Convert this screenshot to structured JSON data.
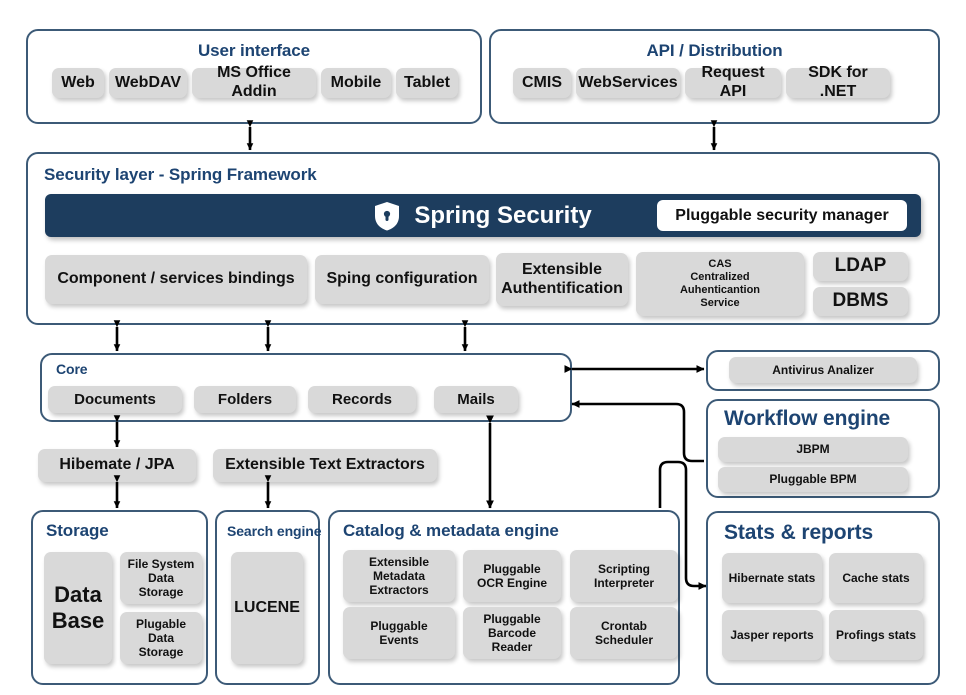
{
  "diagram": {
    "title": "Document management system layered architecture",
    "colors": {
      "panel_border": "#3c5a77",
      "panel_title": "#1d4472",
      "chip_bg": "#d9d9d9",
      "banner_bg": "#1d3d5e",
      "connector": "#000000",
      "background": "#ffffff"
    }
  },
  "user_interface": {
    "title": "User interface",
    "items": [
      {
        "label": "Web"
      },
      {
        "label": "WebDAV"
      },
      {
        "label": "MS Office Addin"
      },
      {
        "label": "Mobile"
      },
      {
        "label": "Tablet"
      }
    ]
  },
  "api_distribution": {
    "title": "API / Distribution",
    "items": [
      {
        "label": "CMIS"
      },
      {
        "label": "WebServices"
      },
      {
        "label": "Request API"
      },
      {
        "label": "SDK for .NET"
      }
    ]
  },
  "security_layer": {
    "title": "Security layer - Spring Framework",
    "banner": {
      "icon": "shield-lock-icon",
      "label": "Spring Security",
      "pluggable_label": "Pluggable security manager"
    },
    "items": [
      {
        "label": "Component / services bindings"
      },
      {
        "label": "Sping configuration"
      },
      {
        "label": "Extensible\nAuthentification"
      },
      {
        "label": "CAS\nCentralized\nAuhenticantion\nService"
      },
      {
        "label": "LDAP"
      },
      {
        "label": "DBMS"
      }
    ]
  },
  "core": {
    "title": "Core",
    "items": [
      {
        "label": "Documents"
      },
      {
        "label": "Folders"
      },
      {
        "label": "Records"
      },
      {
        "label": "Mails"
      }
    ]
  },
  "persistence": {
    "items": [
      {
        "label": "Hibemate / JPA"
      },
      {
        "label": "Extensible Text Extractors"
      }
    ]
  },
  "antivirus": {
    "items": [
      {
        "label": "Antivirus Analizer"
      }
    ]
  },
  "workflow_engine": {
    "title": "Workflow engine",
    "items": [
      {
        "label": "JBPM"
      },
      {
        "label": "Pluggable BPM"
      }
    ]
  },
  "storage": {
    "title": "Storage",
    "items": [
      {
        "label": "Data\nBase"
      },
      {
        "label": "File System\nData Storage"
      },
      {
        "label": "Plugable\nData Storage"
      }
    ]
  },
  "search_engine": {
    "title": "Search engine",
    "items": [
      {
        "label": "LUCENE"
      }
    ]
  },
  "catalog_engine": {
    "title": "Catalog & metadata engine",
    "items": [
      {
        "label": "Extensible\nMetadata Extractors"
      },
      {
        "label": "Pluggable\nOCR Engine"
      },
      {
        "label": "Scripting\nInterpreter"
      },
      {
        "label": "Pluggable Events"
      },
      {
        "label": "Pluggable\nBarcode Reader"
      },
      {
        "label": "Crontab\nScheduler"
      }
    ]
  },
  "stats_reports": {
    "title": "Stats & reports",
    "items": [
      {
        "label": "Hibernate stats"
      },
      {
        "label": "Cache stats"
      },
      {
        "label": "Jasper reports"
      },
      {
        "label": "Profings stats"
      }
    ]
  }
}
